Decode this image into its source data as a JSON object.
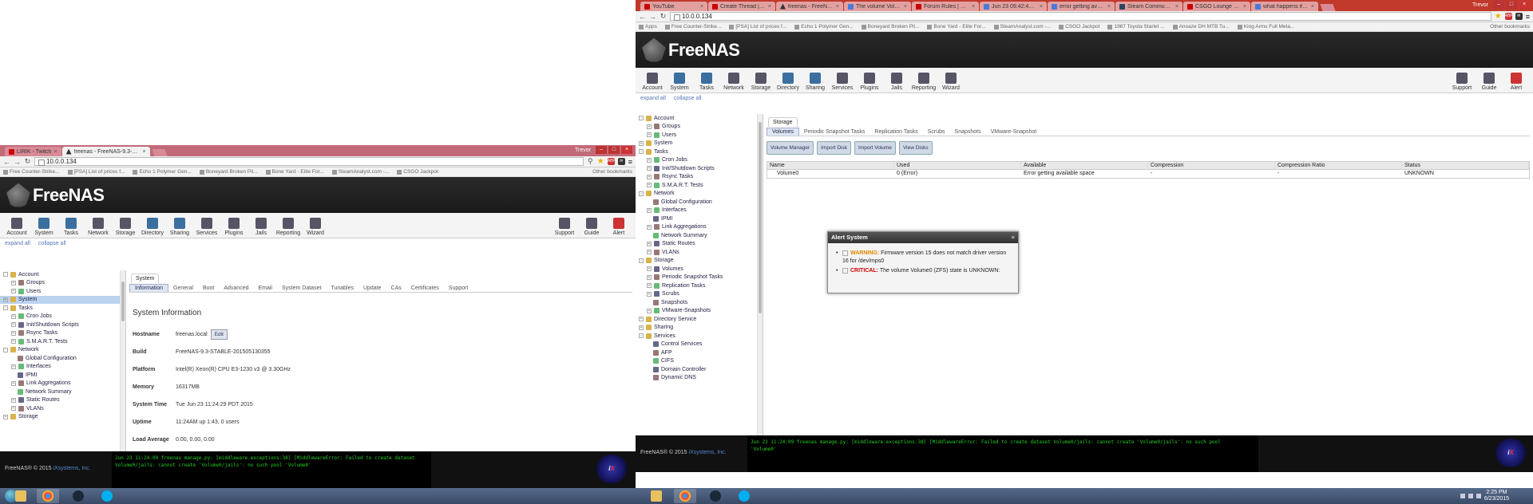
{
  "left": {
    "tabs": [
      {
        "label": "LIRIK - Twitch",
        "icon": "twitch-icon"
      },
      {
        "label": "freenas - FreeNAS-9.3-ST...",
        "icon": "freenas-icon"
      }
    ],
    "url": "10.0.0.134",
    "window_user": "Trevor",
    "bookmarks": [
      "Free Counter-Strike...",
      "[PSA] List of prices f...",
      "Echo 1 Polymer Gen...",
      "Boneyard Broken Pil...",
      "Bone Yard - Elite For...",
      "SteamAnalyst.com -...",
      "CSGO Jackpot"
    ],
    "other_bookmarks": "Other bookmarks",
    "logo": "FreeNAS",
    "toolbar": [
      "Account",
      "System",
      "Tasks",
      "Network",
      "Storage",
      "Directory",
      "Sharing",
      "Services",
      "Plugins",
      "Jails",
      "Reporting",
      "Wizard"
    ],
    "toolbar_right": [
      "Support",
      "Guide",
      "Alert"
    ],
    "expand_all": "expand all",
    "collapse_all": "collapse all",
    "tree": [
      {
        "label": "Account",
        "level": 0,
        "exp": "-"
      },
      {
        "label": "Groups",
        "level": 1,
        "exp": "+"
      },
      {
        "label": "Users",
        "level": 1,
        "exp": "+"
      },
      {
        "label": "System",
        "level": 0,
        "exp": "+",
        "sel": true
      },
      {
        "label": "Tasks",
        "level": 0,
        "exp": "-"
      },
      {
        "label": "Cron Jobs",
        "level": 1,
        "exp": "+"
      },
      {
        "label": "Init/Shutdown Scripts",
        "level": 1,
        "exp": "+"
      },
      {
        "label": "Rsync Tasks",
        "level": 1,
        "exp": "+"
      },
      {
        "label": "S.M.A.R.T. Tests",
        "level": 1,
        "exp": "+"
      },
      {
        "label": "Network",
        "level": 0,
        "exp": "-"
      },
      {
        "label": "Global Configuration",
        "level": 2,
        "exp": ""
      },
      {
        "label": "Interfaces",
        "level": 1,
        "exp": "+"
      },
      {
        "label": "IPMI",
        "level": 2,
        "exp": ""
      },
      {
        "label": "Link Aggregations",
        "level": 1,
        "exp": "+"
      },
      {
        "label": "Network Summary",
        "level": 2,
        "exp": ""
      },
      {
        "label": "Static Routes",
        "level": 1,
        "exp": "+"
      },
      {
        "label": "VLANs",
        "level": 1,
        "exp": "+"
      },
      {
        "label": "Storage",
        "level": 0,
        "exp": "+"
      }
    ],
    "page_tab": "System",
    "subtabs": [
      "Information",
      "General",
      "Boot",
      "Advanced",
      "Email",
      "System Dataset",
      "Tunables",
      "Update",
      "CAs",
      "Certificates",
      "Support"
    ],
    "info_title": "System Information",
    "info": [
      {
        "k": "Hostname",
        "v": "freenas.local",
        "edit": "Edit"
      },
      {
        "k": "Build",
        "v": "FreeNAS-9.3-STABLE-201505130355"
      },
      {
        "k": "Platform",
        "v": "Intel(R) Xeon(R) CPU E3-1230 v3 @ 3.30GHz"
      },
      {
        "k": "Memory",
        "v": "16317MB"
      },
      {
        "k": "System Time",
        "v": "Tue Jun 23 11:24:29 PDT 2015"
      },
      {
        "k": "Uptime",
        "v": "11:24AM up 1:43, 0 users"
      },
      {
        "k": "Load Average",
        "v": "0.00, 0.00, 0.00"
      }
    ],
    "footer_copy": "FreeNAS® © 2015",
    "footer_link": "iXsystems, Inc.",
    "log": "Jun 23 11:24:09 freenas manage.py: [middleware.exceptions:38] [MiddlewareError: Failed to create dataset\nVolume0/jails: cannot create 'Volume0/jails': no such pool 'Volume0'"
  },
  "right": {
    "tabs": [
      {
        "label": "YouTube",
        "icon": "youtube-icon"
      },
      {
        "label": "Create Thread | F...",
        "icon": "forum-icon"
      },
      {
        "label": "freenas - FreeNAS-9...",
        "icon": "freenas-icon",
        "active": true
      },
      {
        "label": "The volume Volume0...",
        "icon": "google-icon"
      },
      {
        "label": "Forum Rules | FreeN...",
        "icon": "forum-icon"
      },
      {
        "label": "Jun 23 09:42:46 free...",
        "icon": "google-icon"
      },
      {
        "label": "error getting availab...",
        "icon": "google-icon"
      },
      {
        "label": "Steam Community :...",
        "icon": "steam-icon"
      },
      {
        "label": "CSGO Lounge - My T...",
        "icon": "forum-icon"
      },
      {
        "label": "what happens if you...",
        "icon": "google-icon"
      }
    ],
    "url": "10.0.0.134",
    "window_user": "Trevor",
    "bookmarks": [
      "Apps",
      "Free Counter-Strike...",
      "[PSA] List of prices f...",
      "Echo 1 Polymer Gen...",
      "Boneyard Broken Pil...",
      "Bone Yard - Elite For...",
      "SteamAnalyst.com -...",
      "CSGO Jackpot",
      "1987 Toyota Starlet ...",
      "Anoaze DH MTB Tu...",
      "King Arms Full Meta..."
    ],
    "other_bookmarks": "Other bookmarks",
    "tree": [
      {
        "label": "Account",
        "level": 0,
        "exp": "-"
      },
      {
        "label": "Groups",
        "level": 1,
        "exp": "+"
      },
      {
        "label": "Users",
        "level": 1,
        "exp": "+"
      },
      {
        "label": "System",
        "level": 0,
        "exp": "+"
      },
      {
        "label": "Tasks",
        "level": 0,
        "exp": "-"
      },
      {
        "label": "Cron Jobs",
        "level": 1,
        "exp": "+"
      },
      {
        "label": "Init/Shutdown Scripts",
        "level": 1,
        "exp": "+"
      },
      {
        "label": "Rsync Tasks",
        "level": 1,
        "exp": "+"
      },
      {
        "label": "S.M.A.R.T. Tests",
        "level": 1,
        "exp": "+"
      },
      {
        "label": "Network",
        "level": 0,
        "exp": "-"
      },
      {
        "label": "Global Configuration",
        "level": 2,
        "exp": ""
      },
      {
        "label": "Interfaces",
        "level": 1,
        "exp": "+"
      },
      {
        "label": "IPMI",
        "level": 2,
        "exp": ""
      },
      {
        "label": "Link Aggregations",
        "level": 1,
        "exp": "+"
      },
      {
        "label": "Network Summary",
        "level": 2,
        "exp": ""
      },
      {
        "label": "Static Routes",
        "level": 1,
        "exp": "+"
      },
      {
        "label": "VLANs",
        "level": 1,
        "exp": "+"
      },
      {
        "label": "Storage",
        "level": 0,
        "exp": "-"
      },
      {
        "label": "Volumes",
        "level": 1,
        "exp": "+"
      },
      {
        "label": "Periodic Snapshot Tasks",
        "level": 1,
        "exp": "+"
      },
      {
        "label": "Replication Tasks",
        "level": 1,
        "exp": "+"
      },
      {
        "label": "Scrubs",
        "level": 1,
        "exp": "+"
      },
      {
        "label": "Snapshots",
        "level": 2,
        "exp": ""
      },
      {
        "label": "VMware-Snapshots",
        "level": 1,
        "exp": "+"
      },
      {
        "label": "Directory Service",
        "level": 0,
        "exp": "+"
      },
      {
        "label": "Sharing",
        "level": 0,
        "exp": "+"
      },
      {
        "label": "Services",
        "level": 0,
        "exp": "-"
      },
      {
        "label": "Control Services",
        "level": 2,
        "exp": ""
      },
      {
        "label": "AFP",
        "level": 2,
        "exp": ""
      },
      {
        "label": "CIFS",
        "level": 2,
        "exp": ""
      },
      {
        "label": "Domain Controller",
        "level": 2,
        "exp": ""
      },
      {
        "label": "Dynamic DNS",
        "level": 2,
        "exp": ""
      }
    ],
    "page_tab": "Storage",
    "subtabs": [
      "Volumes",
      "Periodic Snapshot Tasks",
      "Replication Tasks",
      "Scrubs",
      "Snapshots",
      "VMware-Snapshot"
    ],
    "buttons": [
      "Volume Manager",
      "Import Disk",
      "Import Volume",
      "View Disks"
    ],
    "columns": [
      "Name",
      "Used",
      "Available",
      "Compression",
      "Compression Ratio",
      "Status"
    ],
    "rows": [
      [
        "Volume0",
        "0 (Error)",
        "Error getting available space",
        "-",
        "-",
        "UNKNOWN"
      ]
    ],
    "alert": {
      "title": "Alert System",
      "items": [
        {
          "level": "WARNING:",
          "text": "Firmware version 15 does not match driver version 16 for /dev/mps0"
        },
        {
          "level": "CRITICAL:",
          "text": "The volume Volume0 (ZFS) state is UNKNOWN:"
        }
      ]
    },
    "footer_copy": "FreeNAS® © 2015",
    "footer_link": "iXsystems, Inc.",
    "log": "Jun 23 11:24:09 freenas manage.py: [middleware.exceptions:38] [MiddlewareError: Failed to create dataset Volume0/jails: cannot create 'Volume0/jails': no such pool\n'Volume0'"
  },
  "taskbar": {
    "time": "2:25 PM",
    "date": "6/23/2015"
  }
}
